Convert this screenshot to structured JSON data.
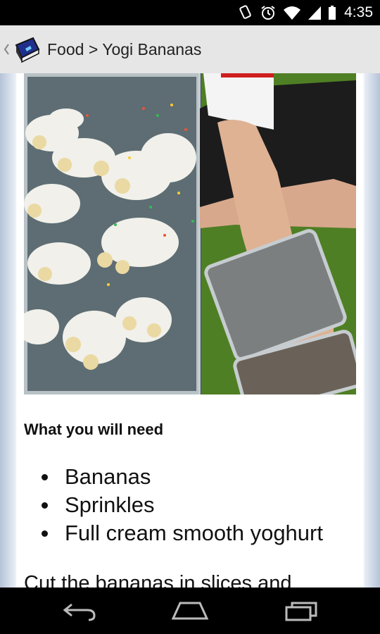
{
  "status_bar": {
    "time": "4:35"
  },
  "action_bar": {
    "breadcrumb": "Food > Yogi Bananas"
  },
  "article": {
    "section_title": "What you will need",
    "ingredients": [
      "Bananas",
      "Sprinkles",
      "Full cream smooth yoghurt"
    ],
    "paragraph": "Cut the bananas in slices and"
  }
}
